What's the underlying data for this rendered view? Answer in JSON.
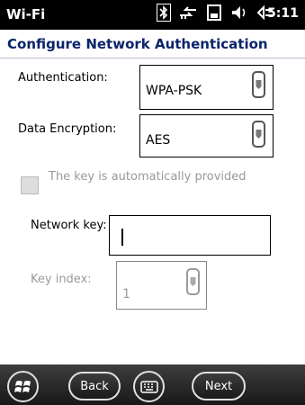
{
  "status": {
    "title": "Wi-Fi",
    "time": "5:11"
  },
  "header": {
    "title": "Configure Network Authentication"
  },
  "form": {
    "authentication_label": "Authentication:",
    "authentication_value": "WPA-PSK",
    "encryption_label": "Data Encryption:",
    "encryption_value": "AES",
    "auto_key_label": "The key is automatically provided",
    "auto_key_checked": false,
    "network_key_label": "Network key:",
    "network_key_value": "",
    "key_index_label": "Key index:",
    "key_index_value": "1"
  },
  "softkeys": {
    "back_label": "Back",
    "next_label": "Next"
  },
  "icons": [
    "bluetooth-icon",
    "data-sync-icon",
    "battery-icon",
    "volume-icon",
    "connection-icon"
  ]
}
